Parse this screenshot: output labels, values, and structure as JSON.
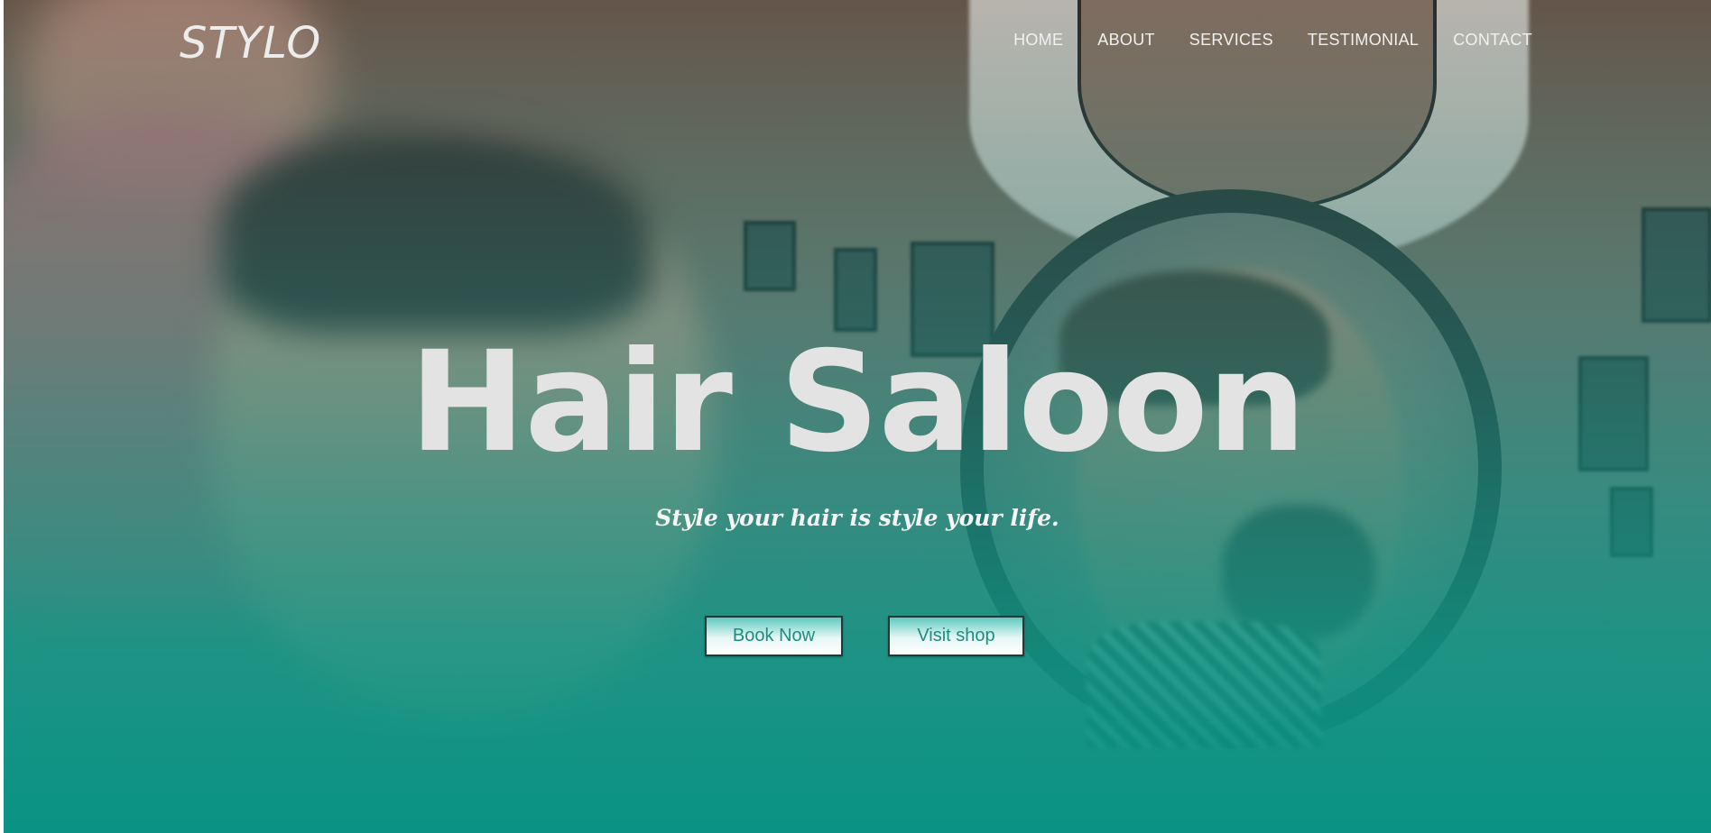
{
  "brand": {
    "logo": "STYLO"
  },
  "nav": {
    "items": [
      {
        "label": "HOME"
      },
      {
        "label": "ABOUT"
      },
      {
        "label": "SERVICES"
      },
      {
        "label": "TESTIMONIAL"
      },
      {
        "label": "CONTACT"
      }
    ]
  },
  "hero": {
    "title": "Hair Saloon",
    "tagline": "Style your hair is style your life.",
    "buttons": {
      "book_label": "Book Now",
      "shop_label": "Visit shop"
    }
  },
  "colors": {
    "accent": "#0e9686",
    "button_text": "#1f8c81",
    "title_text": "#e3e3e3"
  }
}
